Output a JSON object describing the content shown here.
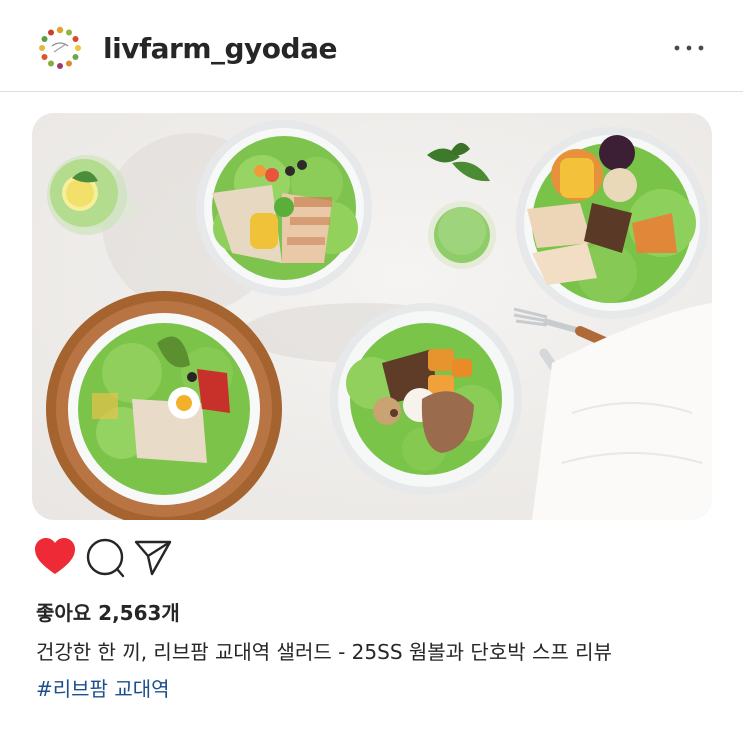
{
  "post": {
    "username": "livfarm_gyodae",
    "more_icon": "ellipsis-horizontal-icon",
    "image_alt": "salad-bowls-photo",
    "likes_text": "좋아요 2,563개",
    "caption": "건강한 한 끼, 리브팜 교대역 샐러드 - 25SS 웜볼과 단호박 스프 리뷰",
    "hashtag": "#리브팜 교대역"
  },
  "actions": {
    "like_icon": "heart-filled-icon",
    "comment_icon": "comment-bubble-icon",
    "share_icon": "paper-plane-icon",
    "liked": true
  },
  "colors": {
    "like_red": "#ed2a35",
    "hashtag_blue": "#1d4f8c",
    "divider": "#dedede",
    "text": "#262626"
  }
}
